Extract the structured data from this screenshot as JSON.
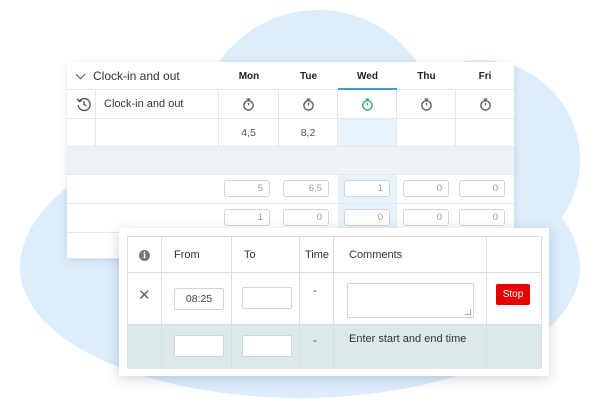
{
  "section": {
    "title": "Clock-in and out"
  },
  "days": [
    "Mon",
    "Tue",
    "Wed",
    "Thu",
    "Fri"
  ],
  "active_day": "Wed",
  "colors": {
    "accent": "#3a9bd9",
    "active_stopwatch": "#2ea36b",
    "stop_button": "#e60000",
    "background_blob": "#dcedfb"
  },
  "clock_row": {
    "label": "Clock-in and out",
    "icon": "history-icon",
    "day_icon": "stopwatch-icon"
  },
  "totals_row": {
    "values": [
      "4,5",
      "8,2",
      "",
      "",
      ""
    ]
  },
  "input_row_1": {
    "values": [
      "5",
      "6,5",
      "1",
      "0",
      "0"
    ]
  },
  "input_row_2": {
    "values": [
      "1",
      "0",
      "0",
      "0",
      "0"
    ]
  },
  "popup": {
    "headers": {
      "from": "From",
      "to": "To",
      "time": "Time",
      "comments": "Comments"
    },
    "entry": {
      "from": "08:25",
      "to": "",
      "time": "-",
      "comment": "",
      "stop_label": "Stop"
    },
    "new_entry": {
      "from": "",
      "to": "",
      "time": "-",
      "hint": "Enter start and end time"
    }
  }
}
